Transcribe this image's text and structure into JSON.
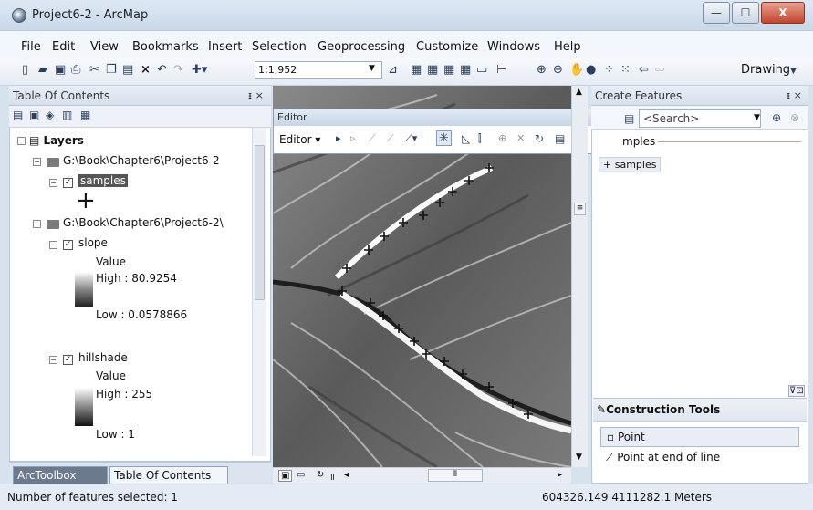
{
  "window": {
    "title": "Project6-2 - ArcMap",
    "minimize": "—",
    "maximize": "☐",
    "close": "X"
  },
  "menu": [
    "File",
    "Edit",
    "View",
    "Bookmarks",
    "Insert",
    "Selection",
    "Geoprocessing",
    "Customize",
    "Windows",
    "Help"
  ],
  "toolbar": {
    "scale": "1:1,952",
    "drawing_label": "Drawing"
  },
  "toc": {
    "title": "Table Of Contents",
    "pin": "ᵻ ×",
    "layers_label": "Layers",
    "group1_path": "G:\\Book\\Chapter6\\Project6-2",
    "samples_label": "samples",
    "group2_path": "G:\\Book\\Chapter6\\Project6-2\\",
    "slope": {
      "name": "slope",
      "value_label": "Value",
      "high": "High : 80.9254",
      "low": "Low : 0.0578866"
    },
    "hillshade": {
      "name": "hillshade",
      "value_label": "Value",
      "high": "High : 255",
      "low": "Low : 1"
    },
    "tab_arctoolbox": "ArcToolbox",
    "tab_toc": "Table Of Contents"
  },
  "editor": {
    "title": "Editor",
    "menu_label": "Editor ▾"
  },
  "create_features": {
    "title": "Create Features",
    "search_placeholder": "<Search>",
    "group_label": "mples",
    "template": "samples"
  },
  "construction_tools": {
    "title": "Construction Tools",
    "items": [
      "Point",
      "Point at end of line"
    ]
  },
  "status": {
    "selected": "Number of features selected: 1",
    "coords": "604326.149  4111282.1 Meters"
  }
}
